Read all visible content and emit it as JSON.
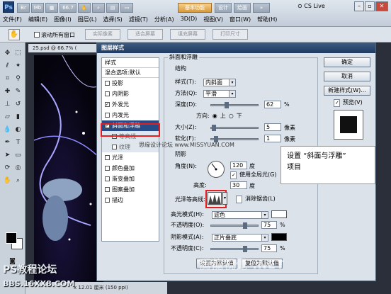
{
  "app": {
    "menus": [
      "文件(F)",
      "编辑(E)",
      "图像(I)",
      "图层(L)",
      "选择(S)",
      "滤镜(T)",
      "分析(A)",
      "3D(D)",
      "视图(V)",
      "窗口(W)",
      "帮助(H)"
    ],
    "workspace_label": "基本功能",
    "cs_live": "CS Live",
    "options_bar": {
      "scroll_all_label": "滚动所有窗口",
      "buttons": [
        "实际像素",
        "适合屏幕",
        "填充屏幕",
        "打印尺寸"
      ]
    },
    "doc_tab": "25.psd @ 66.7% (",
    "status_text": "x 12.01 厘米 (150 ppi)"
  },
  "dialog": {
    "title": "图层样式",
    "styles_header": "样式",
    "blend_header": "混合选项:默认",
    "style_items": [
      {
        "label": "投影",
        "checked": false
      },
      {
        "label": "内阴影",
        "checked": false
      },
      {
        "label": "外发光",
        "checked": true
      },
      {
        "label": "内发光",
        "checked": false
      },
      {
        "label": "斜面和浮雕",
        "checked": true,
        "selected": true
      },
      {
        "label": "等高线",
        "checked": false,
        "sub": true
      },
      {
        "label": "纹理",
        "checked": false,
        "sub": true
      },
      {
        "label": "光泽",
        "checked": false
      },
      {
        "label": "颜色叠加",
        "checked": false
      },
      {
        "label": "渐变叠加",
        "checked": false
      },
      {
        "label": "图案叠加",
        "checked": false
      },
      {
        "label": "描边",
        "checked": false
      }
    ],
    "panel_title": "斜面和浮雕",
    "structure": {
      "group": "结构",
      "style_label": "样式(T):",
      "style_value": "内斜面",
      "technique_label": "方法(Q):",
      "technique_value": "平滑",
      "depth_label": "深度(D):",
      "depth_value": "62",
      "depth_unit": "%",
      "depth_level": 0.31,
      "direction_label": "方向:",
      "direction_up": "上",
      "direction_down": "下",
      "size_label": "大小(Z):",
      "size_value": "5",
      "size_unit": "像素",
      "size_level": 0.02,
      "soften_label": "软化(F):",
      "soften_value": "1",
      "soften_unit": "像素",
      "soften_level": 0.06
    },
    "shading": {
      "group": "阴影",
      "angle_label": "角度(N):",
      "angle_value": "120",
      "angle_unit": "度",
      "global_light_label": "使用全局光(G)",
      "global_light_checked": true,
      "altitude_label": "高度:",
      "altitude_value": "30",
      "altitude_unit": "度",
      "gloss_contour_label": "光泽等高线:",
      "anti_alias_label": "消除锯齿(L)",
      "anti_alias_checked": false,
      "highlight_mode_label": "高光模式(H):",
      "highlight_mode_value": "滤色",
      "highlight_color": "#ffffff",
      "highlight_opacity_label": "不透明度(O):",
      "highlight_opacity_value": "75",
      "highlight_opacity_level": 0.75,
      "shadow_mode_label": "阴影模式(A):",
      "shadow_mode_value": "正片叠底",
      "shadow_color": "#000000",
      "shadow_opacity_label": "不透明度(C):",
      "shadow_opacity_value": "75",
      "shadow_opacity_level": 0.75,
      "opacity_unit": "%"
    },
    "bottom_buttons": {
      "make_default": "设置为默认值",
      "reset_default": "复位为默认值"
    },
    "right_buttons": {
      "ok": "确定",
      "cancel": "取消",
      "new_style": "新建样式(W)...",
      "preview_label": "预览(V)",
      "preview_checked": true
    }
  },
  "callout": {
    "line1": "设置 “斜面与浮雕”",
    "line2": "项目"
  },
  "watermarks": {
    "site_mid": "思缘设计论坛 www.MISSYUAN.COM",
    "forum": "PS教程论坛",
    "bbs": "BBS.16XX8.COM",
    "bottom": "腾龍視覺 .NET"
  }
}
